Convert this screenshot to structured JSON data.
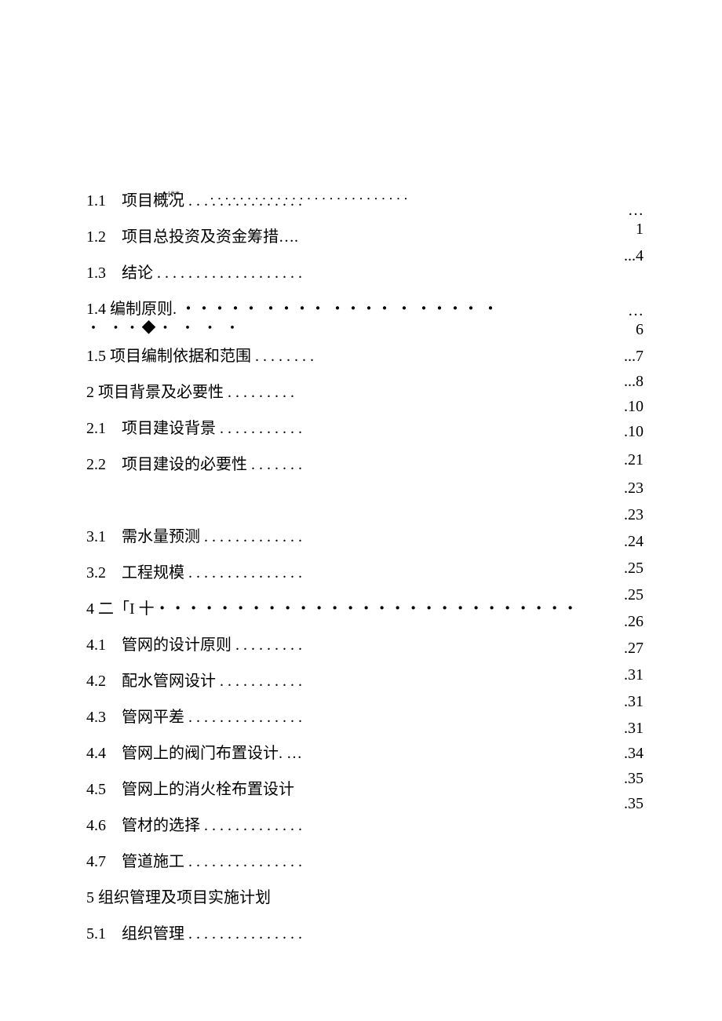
{
  "header_marks": "∧i**",
  "header_dots": "・・・・・・・・・・・・・・・・・・・・・・・・・・・",
  "toc": [
    {
      "label": "1.1　项目概况 . . . . . . . . . . . . . . .",
      "page": ""
    },
    {
      "label": "1.2　项目总投资及资金筹措….",
      "page": ""
    },
    {
      "label": "1.3　结论 . . . . . . . . . . . . . . . . . . .",
      "page": ""
    },
    {
      "label": "1.4 编制原则. ・・・・・ ・・・・ ・・・・ ・ ・・・・ ・",
      "page": ""
    },
    {
      "label": "1.5 项目编制依据和范围 . . . . . . . .",
      "page": ""
    },
    {
      "label": "2 项目背景及必要性 . . . . . . . . .",
      "page": ""
    },
    {
      "label": "2.1　项目建设背景 . . . . . . . . . . .",
      "page": ""
    },
    {
      "label": "2.2　项目建设的必要性 . . . . . . .",
      "page": ""
    },
    {
      "label": "",
      "page": ""
    },
    {
      "label": "3.1　需水量预测 . . . . . . . . . . . . .",
      "page": ""
    },
    {
      "label": "3.2　工程规模 . . . . . . . . . . . . . . .",
      "page": ""
    },
    {
      "label": "4 二「I 十・・・・・・・・・・・・・・・・・・・・・・・・・・・",
      "page": ""
    },
    {
      "label": "4.1　管网的设计原则 . . . . . . . . .",
      "page": ""
    },
    {
      "label": "4.2　配水管网设计 . . . . . . . . . . .",
      "page": ""
    },
    {
      "label": "4.3　管网平差 . . . . . . . . . . . . . . .",
      "page": ""
    },
    {
      "label": "4.4　管网上的阀门布置设计. …",
      "page": ""
    },
    {
      "label": "4.5　管网上的消火栓布置设计",
      "page": ""
    },
    {
      "label": "4.6　管材的选择 . . . . . . . . . . . . .",
      "page": ""
    },
    {
      "label": "4.7　管道施工 . . . . . . . . . . . . . . .",
      "page": ""
    },
    {
      "label": "5 组织管理及项目实施计划",
      "page": ""
    },
    {
      "label": "5.1　组织管理 . . . . . . . . . . . . . . .",
      "page": ""
    }
  ],
  "extra_line": "・ ・・◆・ ・ ・ ・",
  "right_pages": [
    "…\n1",
    "...4",
    "",
    "…\n6",
    "...7",
    "...8",
    ".10",
    ".10",
    ".21",
    ".23",
    ".23",
    ".24",
    ".25",
    ".25",
    ".26",
    ".27",
    ".31",
    ".31",
    ".31",
    ".34",
    ".35",
    ".35"
  ]
}
